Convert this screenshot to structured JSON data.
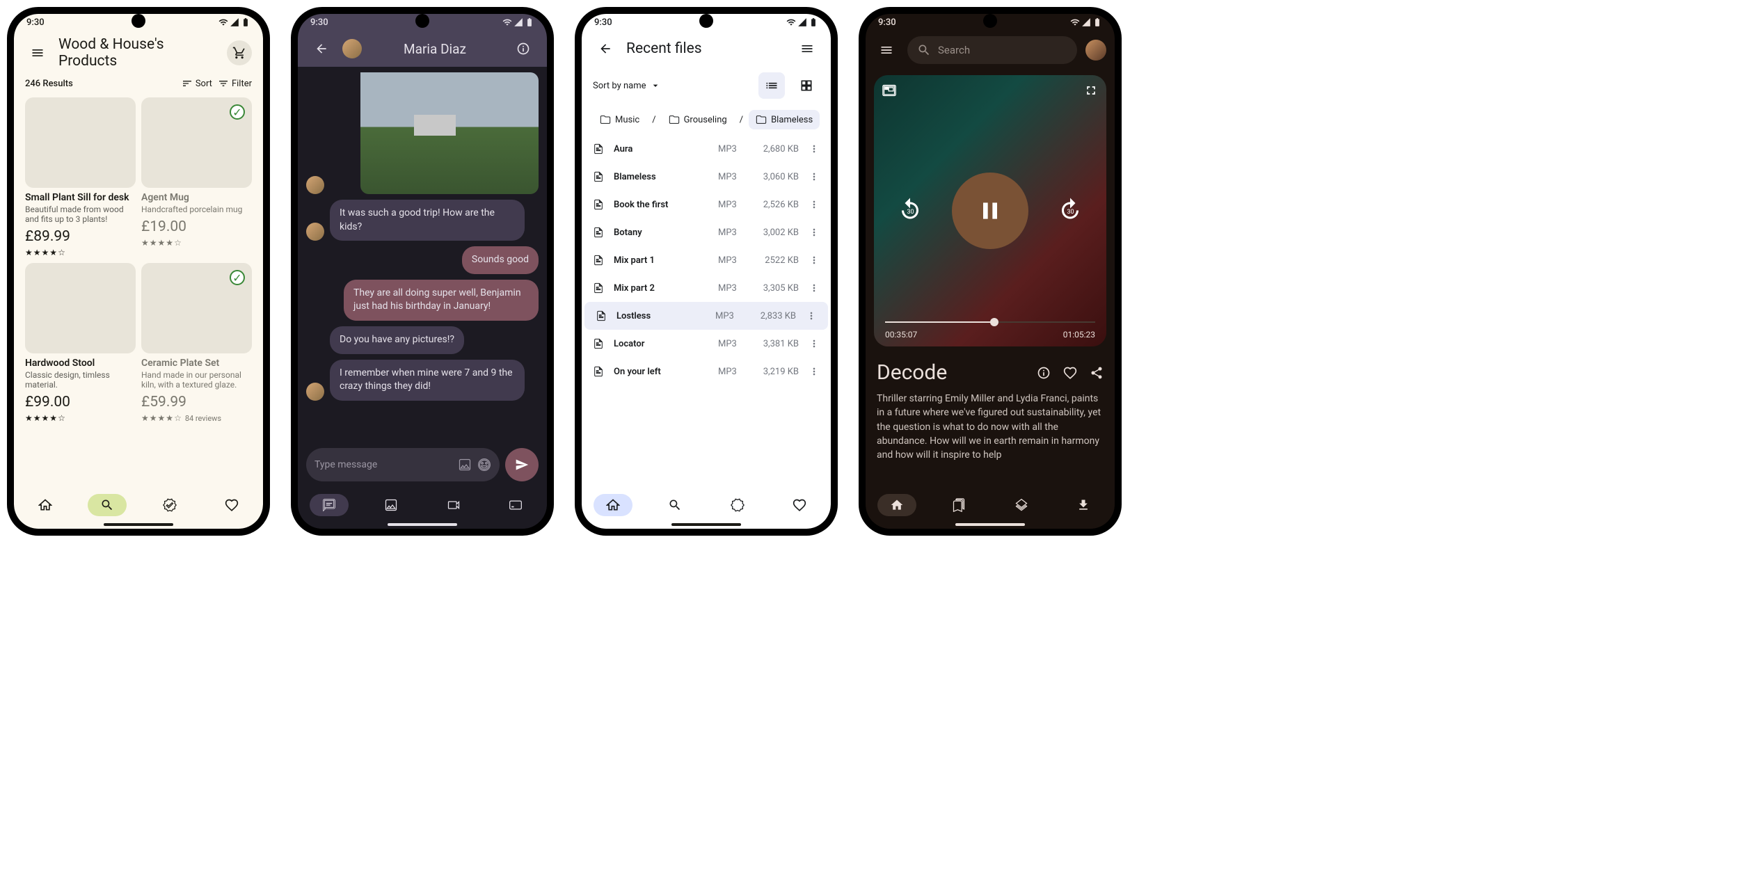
{
  "statusbar_time": "9:30",
  "shop": {
    "title": "Wood & House's Products",
    "result_count": "246 Results",
    "sort_label": "Sort",
    "filter_label": "Filter",
    "products": [
      {
        "title": "Small Plant Sill for desk",
        "desc": "Beautiful made from wood and fits up to 3 plants!",
        "price": "£89.99",
        "rating": 4.5,
        "badge": false
      },
      {
        "title": "Agent Mug",
        "desc": "Handcrafted porcelain mug",
        "price": "£19.00",
        "rating": 4.5,
        "badge": true
      },
      {
        "title": "Hardwood Stool",
        "desc": "Classic design, timless material.",
        "price": "£99.00",
        "rating": 4.5,
        "badge": false
      },
      {
        "title": "Ceramic Plate Set",
        "desc": "Hand made in our personal kiln, with a textured glaze.",
        "price": "£59.99",
        "rating": 4.5,
        "badge": true,
        "reviews": "84 reviews"
      }
    ]
  },
  "chat": {
    "title": "Maria Diaz",
    "messages": [
      {
        "dir": "in",
        "text": "It was such a good trip! How are the kids?",
        "showAvatar": true
      },
      {
        "dir": "out",
        "text": "Sounds good"
      },
      {
        "dir": "out",
        "text": "They are all doing super well, Benjamin just had his birthday in January!"
      },
      {
        "dir": "in",
        "text": "Do you have any pictures!?",
        "showAvatar": false
      },
      {
        "dir": "in",
        "text": "I remember when mine were 7 and 9 the crazy things they did!",
        "showAvatar": true
      }
    ],
    "input_placeholder": "Type message"
  },
  "files": {
    "title": "Recent files",
    "sort_by": "Sort by name",
    "breadcrumbs": [
      "Music",
      "Grouseling",
      "Blameless"
    ],
    "sep": "/",
    "list": [
      {
        "name": "Aura",
        "type": "MP3",
        "size": "2,680 KB"
      },
      {
        "name": "Blameless",
        "type": "MP3",
        "size": "3,060 KB"
      },
      {
        "name": "Book the first",
        "type": "MP3",
        "size": "2,526 KB"
      },
      {
        "name": "Botany",
        "type": "MP3",
        "size": "3,002 KB"
      },
      {
        "name": "Mix part 1",
        "type": "MP3",
        "size": "2522 KB"
      },
      {
        "name": "Mix part 2",
        "type": "MP3",
        "size": "3,305 KB"
      },
      {
        "name": "Lostless",
        "type": "MP3",
        "size": "2,833 KB",
        "selected": true
      },
      {
        "name": "Locator",
        "type": "MP3",
        "size": "3,381 KB"
      },
      {
        "name": "On your left",
        "type": "MP3",
        "size": "3,219 KB"
      }
    ]
  },
  "media": {
    "search_placeholder": "Search",
    "time_elapsed": "00:35:07",
    "time_total": "01:05:23",
    "title": "Decode",
    "description": "Thriller starring Emily Miller and Lydia Franci, paints in a future where we've figured out sustainability, yet the question is what to do now with all the abundance. How will we in earth remain in harmony and how will it inspire to help"
  }
}
